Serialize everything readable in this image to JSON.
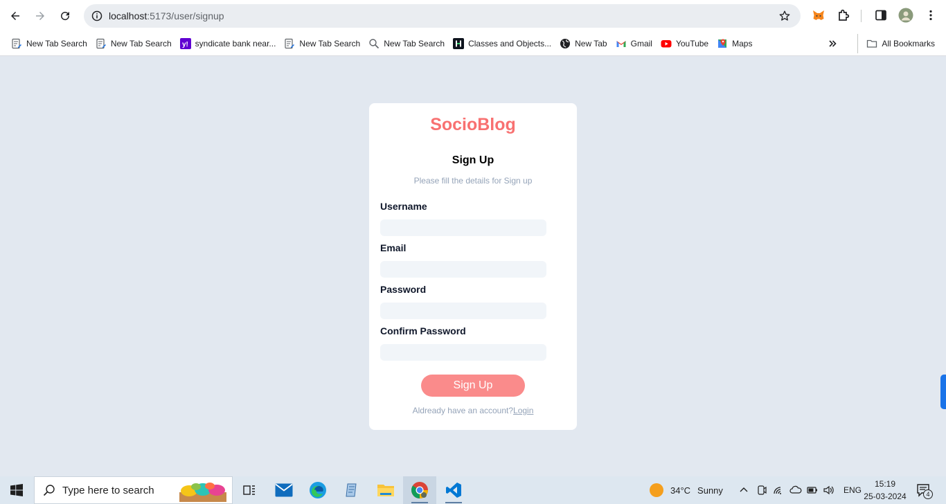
{
  "browser": {
    "url_host": "localhost",
    "url_rest": ":5173/user/signup"
  },
  "bookmarks": [
    {
      "label": "New Tab Search",
      "icon": "page-edit-icon"
    },
    {
      "label": "New Tab Search",
      "icon": "page-edit-icon"
    },
    {
      "label": "syndicate bank near...",
      "icon": "yahoo-icon"
    },
    {
      "label": "New Tab Search",
      "icon": "page-edit-icon"
    },
    {
      "label": "New Tab Search",
      "icon": "search-icon"
    },
    {
      "label": "Classes and Objects...",
      "icon": "hackerrank-icon"
    },
    {
      "label": "New Tab",
      "icon": "globe-icon"
    },
    {
      "label": "Gmail",
      "icon": "gmail-icon"
    },
    {
      "label": "YouTube",
      "icon": "youtube-icon"
    },
    {
      "label": "Maps",
      "icon": "maps-icon"
    }
  ],
  "bookmarks_all_label": "All Bookmarks",
  "signup": {
    "brand": "SocioBlog",
    "title": "Sign Up",
    "subtitle": "Please fill the details for Sign up",
    "username_label": "Username",
    "email_label": "Email",
    "password_label": "Password",
    "confirm_label": "Confirm Password",
    "username_value": "",
    "email_value": "",
    "password_value": "",
    "confirm_value": "",
    "button_label": "Sign Up",
    "footer_text": "Aldready have an account?",
    "login_link": "Login"
  },
  "colors": {
    "brand": "#f87171",
    "button": "#fa8b8b",
    "page_bg": "#e2e8f0",
    "input_bg": "#f1f5f9"
  },
  "taskbar": {
    "search_placeholder": "Type here to search",
    "weather_temp": "34°C",
    "weather_text": "Sunny",
    "language": "ENG",
    "time": "15:19",
    "date": "25-03-2024",
    "notifications": "4"
  }
}
